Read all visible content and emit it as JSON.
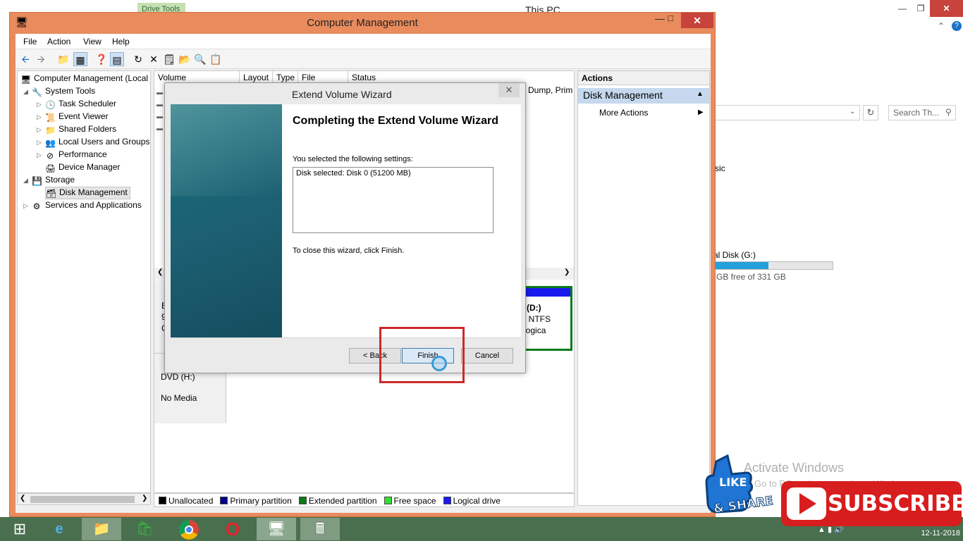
{
  "background_window": {
    "title": "This PC",
    "ribbon_tab": "Drive Tools",
    "search_placeholder": "Search Th...",
    "partial_text_1": "sic",
    "drive_name": "al Disk (G:)",
    "drive_free": "GB free of 331 GB",
    "drive_usage_fraction": 0.45,
    "activate_title": "Activate Windows",
    "activate_sub": "Go to PC settings to activate Windows."
  },
  "computer_management": {
    "title": "Computer Management",
    "menu": [
      "File",
      "Action",
      "View",
      "Help"
    ],
    "tree": {
      "root": "Computer Management (Local",
      "system_tools": "System Tools",
      "task_scheduler": "Task Scheduler",
      "event_viewer": "Event Viewer",
      "shared_folders": "Shared Folders",
      "local_users": "Local Users and Groups",
      "performance": "Performance",
      "device_manager": "Device Manager",
      "storage": "Storage",
      "disk_management": "Disk Management",
      "services": "Services and Applications"
    },
    "columns": [
      "Volume",
      "Layout",
      "Type",
      "File System",
      "Status"
    ],
    "partial_status": "n Dump, Prim",
    "disk0_partial": [
      "B",
      "9",
      "O"
    ],
    "volume_d": {
      "label": "ume (D:)",
      "size": "0 GB NTFS",
      "status": "hy (Logica"
    },
    "dvd": {
      "label": "DVD (H:)",
      "media": "No Media"
    },
    "legend": [
      "Unallocated",
      "Primary partition",
      "Extended partition",
      "Free space",
      "Logical drive"
    ],
    "legend_colors": [
      "#000000",
      "#00008b",
      "#0a7a1a",
      "#33dd33",
      "#1a1aee"
    ],
    "actions": {
      "title": "Actions",
      "section": "Disk Management",
      "more": "More Actions"
    }
  },
  "wizard": {
    "title": "Extend Volume Wizard",
    "heading": "Completing the Extend Volume Wizard",
    "selected_label": "You selected the following settings:",
    "selected_value": "Disk selected: Disk 0 (51200 MB)",
    "close_text": "To close this wizard, click Finish.",
    "back_button": "< Back",
    "finish_button": "Finish",
    "cancel_button": "Cancel"
  },
  "taskbar": {
    "date": "12-11-2018",
    "time": ""
  },
  "overlays": {
    "like_line1": "LIKE",
    "like_line2": "& SHARE",
    "subscribe": "SUBSCRIBE"
  }
}
